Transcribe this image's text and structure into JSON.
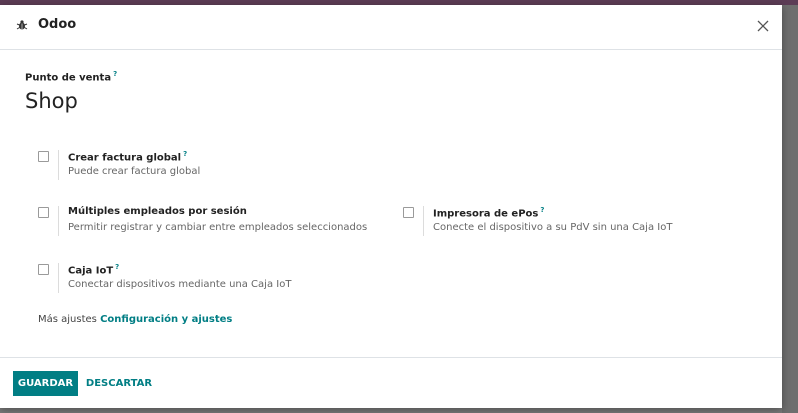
{
  "dialog": {
    "title": "Odoo",
    "title_icon": "bug-icon",
    "close_icon": "close-icon"
  },
  "pos": {
    "label": "Punto de venta",
    "help": "?",
    "value": "Shop"
  },
  "settings": [
    {
      "title": "Crear factura global",
      "help": "?",
      "description": "Puede crear factura global",
      "checked": false
    },
    {
      "title": "Múltiples empleados por sesión",
      "help": "",
      "description": "Permitir registrar y cambiar entre empleados seleccionados",
      "checked": false
    },
    {
      "title": "Impresora de ePos",
      "help": "?",
      "description": "Conecte el dispositivo a su PdV sin una Caja IoT",
      "checked": false
    },
    {
      "title": "Caja IoT",
      "help": "?",
      "description": "Conectar dispositivos mediante una Caja IoT",
      "checked": false
    }
  ],
  "more_settings": {
    "prefix": "Más ajustes",
    "link": "Configuración y ajustes"
  },
  "footer": {
    "save_label": "GUARDAR",
    "discard_label": "DESCARTAR"
  },
  "colors": {
    "accent": "#017e84",
    "backdrop_bar": "#5c3c55"
  }
}
